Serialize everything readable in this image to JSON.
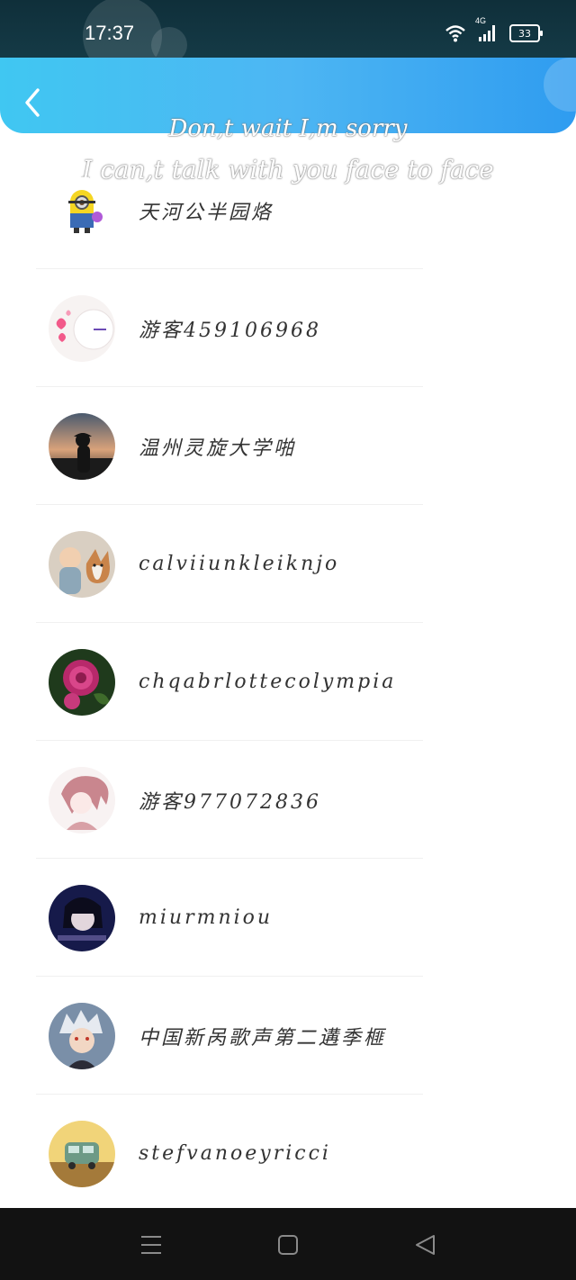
{
  "status_bar": {
    "time": "17:37",
    "network": "4G",
    "battery": "33"
  },
  "header": {
    "back_icon": "chevron-left-icon"
  },
  "overlay": {
    "line1": "Don,t wait I,m sorry",
    "line2": "I can,t talk with you face to face"
  },
  "users": [
    {
      "name": "天河公半园烙"
    },
    {
      "name": "游客459106968"
    },
    {
      "name": "温州灵旋大学啪"
    },
    {
      "name": "calviiunkleiknjo"
    },
    {
      "name": "chqabrlottecolympia"
    },
    {
      "name": "游客977072836"
    },
    {
      "name": "miurmniou"
    },
    {
      "name": "中国新呙歌声第二遘季榧"
    },
    {
      "name": "stefvanoeyricci"
    }
  ],
  "nav_bar": {
    "menu_icon": "menu-icon",
    "home_icon": "home-square-icon",
    "back_icon": "back-triangle-icon"
  }
}
